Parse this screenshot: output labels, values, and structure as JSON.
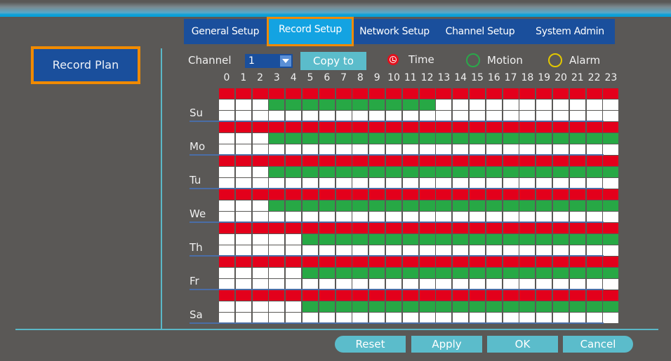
{
  "tabs": [
    {
      "label": "General Setup",
      "active": false
    },
    {
      "label": "Record Setup",
      "active": true
    },
    {
      "label": "Network Setup",
      "active": false
    },
    {
      "label": "Channel Setup",
      "active": false
    },
    {
      "label": "System Admin",
      "active": false
    }
  ],
  "sidebar": {
    "items": [
      {
        "label": "Record Plan",
        "active": true
      }
    ]
  },
  "controls": {
    "channel_label": "Channel",
    "channel_value": "1",
    "copy_to_label": "Copy to"
  },
  "legend": {
    "time": {
      "label": "Time",
      "icon": "clock-icon",
      "color": "#e3001b"
    },
    "motion": {
      "label": "Motion",
      "icon": "circle-outline-icon",
      "color": "#27a845"
    },
    "alarm": {
      "label": "Alarm",
      "icon": "circle-outline-icon",
      "color": "#e3c800"
    }
  },
  "hours": [
    "0",
    "1",
    "2",
    "3",
    "4",
    "5",
    "6",
    "7",
    "8",
    "9",
    "10",
    "11",
    "12",
    "13",
    "14",
    "15",
    "16",
    "17",
    "18",
    "19",
    "20",
    "21",
    "22",
    "23"
  ],
  "schedule": [
    {
      "day": "Su",
      "time": [
        [
          0,
          23
        ]
      ],
      "motion": [
        [
          3,
          12
        ]
      ],
      "alarm": []
    },
    {
      "day": "Mo",
      "time": [
        [
          0,
          23
        ]
      ],
      "motion": [
        [
          3,
          23
        ]
      ],
      "alarm": []
    },
    {
      "day": "Tu",
      "time": [
        [
          0,
          23
        ]
      ],
      "motion": [
        [
          3,
          23
        ]
      ],
      "alarm": []
    },
    {
      "day": "We",
      "time": [
        [
          0,
          23
        ]
      ],
      "motion": [
        [
          3,
          23
        ]
      ],
      "alarm": []
    },
    {
      "day": "Th",
      "time": [
        [
          0,
          23
        ]
      ],
      "motion": [
        [
          5,
          23
        ]
      ],
      "alarm": []
    },
    {
      "day": "Fr",
      "time": [
        [
          0,
          23
        ]
      ],
      "motion": [
        [
          5,
          23
        ]
      ],
      "alarm": []
    },
    {
      "day": "Sa",
      "time": [
        [
          0,
          23
        ]
      ],
      "motion": [
        [
          5,
          23
        ]
      ],
      "alarm": []
    }
  ],
  "buttons": {
    "reset": "Reset",
    "apply": "Apply",
    "ok": "OK",
    "cancel": "Cancel"
  }
}
